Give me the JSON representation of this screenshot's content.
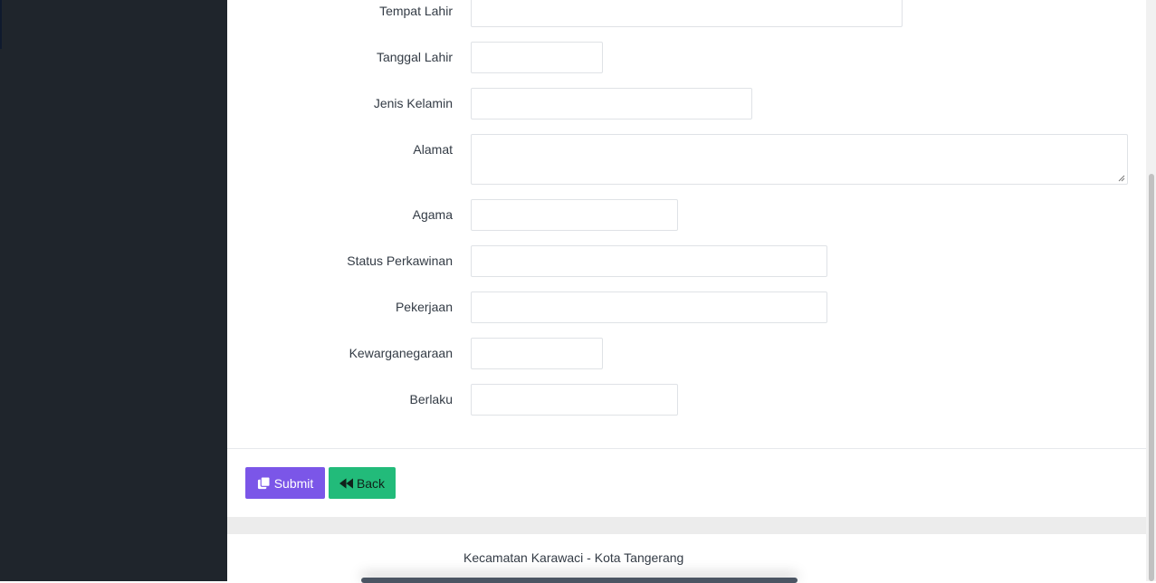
{
  "form": {
    "fields": [
      {
        "label": "Tempat Lahir",
        "value": ""
      },
      {
        "label": "Tanggal Lahir",
        "value": ""
      },
      {
        "label": "Jenis Kelamin",
        "value": ""
      },
      {
        "label": "Alamat",
        "value": ""
      },
      {
        "label": "Agama",
        "value": ""
      },
      {
        "label": "Status Perkawinan",
        "value": ""
      },
      {
        "label": "Pekerjaan",
        "value": ""
      },
      {
        "label": "Kewarganegaraan",
        "value": ""
      },
      {
        "label": "Berlaku",
        "value": ""
      }
    ]
  },
  "actions": {
    "submit_label": "Submit",
    "submit_icon": "copy-icon",
    "back_label": "Back",
    "back_icon": "backward-icon"
  },
  "footer": {
    "text": "Kecamatan Karawaci - Kota Tangerang"
  },
  "colors": {
    "sidebar": "#1f252c",
    "submit": "#7b56e8",
    "back": "#22bb7a"
  }
}
